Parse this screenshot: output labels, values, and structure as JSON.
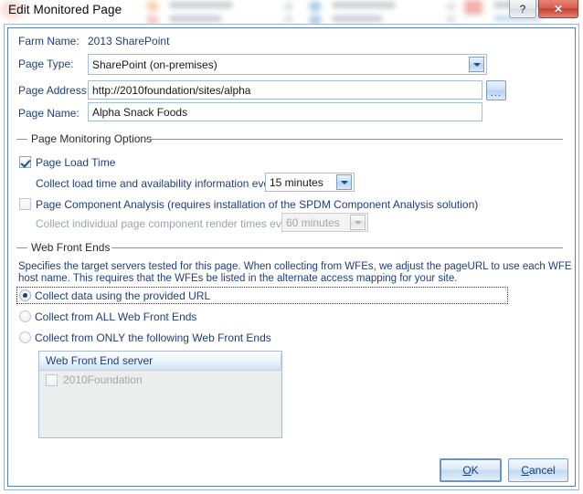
{
  "window": {
    "title": "Edit Monitored Page",
    "help_button": "?",
    "close_button": "✕",
    "help_icon": "question-mark-icon",
    "close_icon": "close-x-icon"
  },
  "fields": {
    "farm_name_label": "Farm Name:",
    "farm_name_value": "2013 SharePoint",
    "page_type_label": "Page Type:",
    "page_type_value": "SharePoint (on-premises)",
    "page_address_label": "Page Address:",
    "page_address_value": "http://2010foundation/sites/alpha",
    "page_address_placeholder": "http://",
    "browse_button_label": "...",
    "page_name_label": "Page Name:",
    "page_name_value": "Alpha Snack Foods",
    "page_name_placeholder": "Page name"
  },
  "monitoring": {
    "group_title": "Page Monitoring Options",
    "page_load_time_label": "Page Load Time",
    "page_load_time_checked": true,
    "load_interval_label": "Collect load time and availability information every",
    "load_interval_value": "15 minutes",
    "component_analysis_label": "Page Component Analysis (requires installation of the SPDM Component Analysis solution)",
    "component_analysis_checked": false,
    "component_interval_label": "Collect individual page component render times every",
    "component_interval_value": "60 minutes"
  },
  "web_front_ends": {
    "group_title": "Web Front Ends",
    "description_line1": "Specifies the target servers tested for this page.  When collecting from WFEs, we adjust the pageURL to use each WFE",
    "description_line2": "host name.  This requires that the WFEs be listed in the alternate access mapping for your site.",
    "options": [
      {
        "label": "Collect data using the provided URL",
        "selected": true,
        "focused": true
      },
      {
        "label": "Collect from ALL Web Front Ends",
        "selected": false,
        "focused": false
      },
      {
        "label": "Collect from ONLY the following Web Front Ends",
        "selected": false,
        "focused": false
      }
    ],
    "list": {
      "column_header": "Web Front End server",
      "rows": [
        {
          "name": "2010Foundation",
          "checked": false
        }
      ]
    }
  },
  "footer": {
    "ok_accel": "O",
    "ok_rest": "K",
    "cancel_accel": "C",
    "cancel_rest": "ancel"
  },
  "colors": {
    "label_blue": "#1f3f7a",
    "accent_border": "#5a80ba",
    "close_red": "#c4402f",
    "disabled_gray": "#a3a8ad"
  }
}
